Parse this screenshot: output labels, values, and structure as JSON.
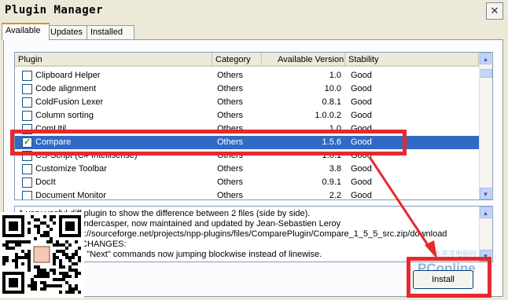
{
  "window": {
    "title": "Plugin Manager"
  },
  "tabs": [
    {
      "label": "Available",
      "active": true
    },
    {
      "label": "Updates",
      "active": false
    },
    {
      "label": "Installed",
      "active": false
    }
  ],
  "table": {
    "columns": [
      "Plugin",
      "Category",
      "Available Version",
      "Stability"
    ],
    "rows": [
      {
        "name": "Clipboard Helper",
        "category": "Others",
        "version": "1.0",
        "stability": "Good",
        "checked": false,
        "selected": false
      },
      {
        "name": "Code alignment",
        "category": "Others",
        "version": "10.0",
        "stability": "Good",
        "checked": false,
        "selected": false
      },
      {
        "name": "ColdFusion Lexer",
        "category": "Others",
        "version": "0.8.1",
        "stability": "Good",
        "checked": false,
        "selected": false
      },
      {
        "name": "Column sorting",
        "category": "Others",
        "version": "1.0.0.2",
        "stability": "Good",
        "checked": false,
        "selected": false
      },
      {
        "name": "ComUtil",
        "category": "Others",
        "version": "1.0",
        "stability": "Good",
        "checked": false,
        "selected": false
      },
      {
        "name": "Compare",
        "category": "Others",
        "version": "1.5.6",
        "stability": "Good",
        "checked": true,
        "selected": true
      },
      {
        "name": "CS-Script (C# Intellisense)",
        "category": "Others",
        "version": "1.0.1",
        "stability": "Good",
        "checked": false,
        "selected": false
      },
      {
        "name": "Customize Toolbar",
        "category": "Others",
        "version": "3.8",
        "stability": "Good",
        "checked": false,
        "selected": false
      },
      {
        "name": "DocIt",
        "category": "Others",
        "version": "0.9.1",
        "stability": "Good",
        "checked": false,
        "selected": false
      },
      {
        "name": "Document Monitor",
        "category": "Others",
        "version": "2.2",
        "stability": "Good",
        "checked": false,
        "selected": false
      }
    ]
  },
  "description": {
    "lines": [
      "A very useful diff plugin to show the difference between 2 files (side by side).",
      "Created by Ty Landercasper, now maintained and updated by Jean-Sebastien Leroy",
      "Homepage: https://sourceforge.net/projects/npp-plugins/files/ComparePlugin/Compare_1_5_5_src.zip/download",
      "Release notes - CHANGES:",
      "1. \"Previous\" and \"Next\" commands now jumping blockwise instead of linewise."
    ]
  },
  "buttons": {
    "install": "Install",
    "close": "✕"
  },
  "watermark": {
    "brand": "PConline",
    "sub": "太平洋电脑网"
  },
  "colors": {
    "highlight": "#e52a2f",
    "selection": "#316ac5"
  },
  "icons": {
    "qr": "qr-code-icon"
  }
}
